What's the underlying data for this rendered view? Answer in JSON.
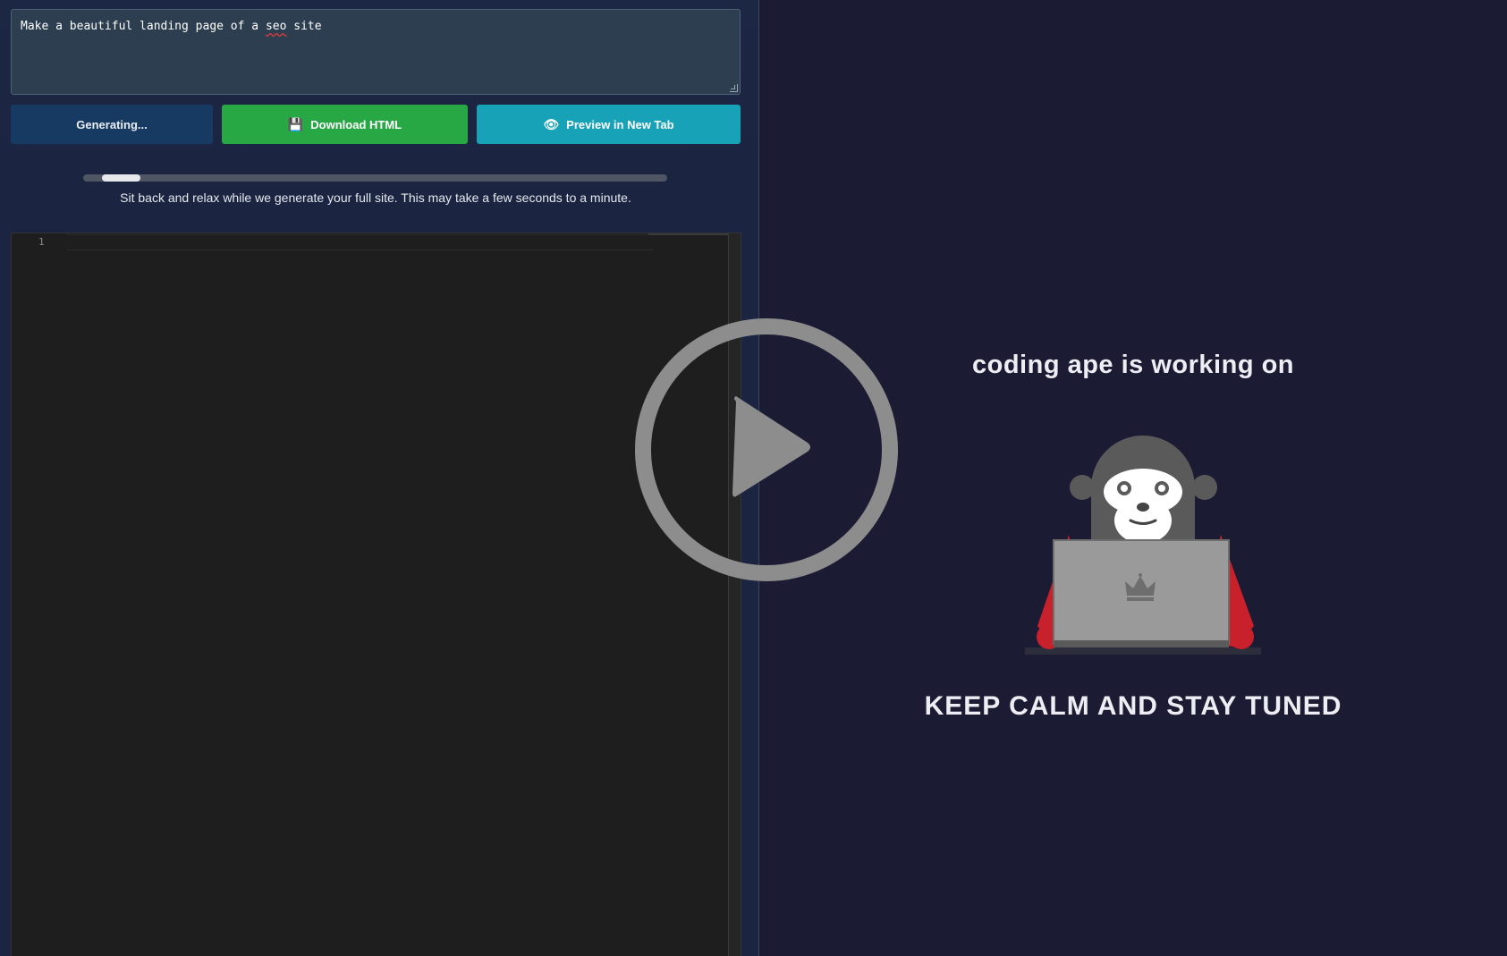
{
  "prompt": {
    "text_before": "Make a beautiful landing page of a ",
    "misspelled": "seo",
    "text_after": " site"
  },
  "actions": {
    "generate_label": "Generating...",
    "download_label": "Download HTML",
    "download_icon": "floppy-disk-icon",
    "preview_label": "Preview in New Tab",
    "preview_icon": "eye-icon"
  },
  "progress": {
    "fraction": 0.1,
    "message": "Sit back and relax while we generate your full site. This may take a few seconds to a minute."
  },
  "editor": {
    "line_numbers": [
      "1"
    ]
  },
  "loading": {
    "status_text": "coding ape is working on",
    "tagline": "KEEP CALM AND STAY TUNED",
    "laptop_logo": "crown-icon"
  },
  "colors": {
    "download_button": "#28a745",
    "preview_button": "#17a2b8",
    "generate_button": "#173a63",
    "background": "#1b1c33"
  }
}
